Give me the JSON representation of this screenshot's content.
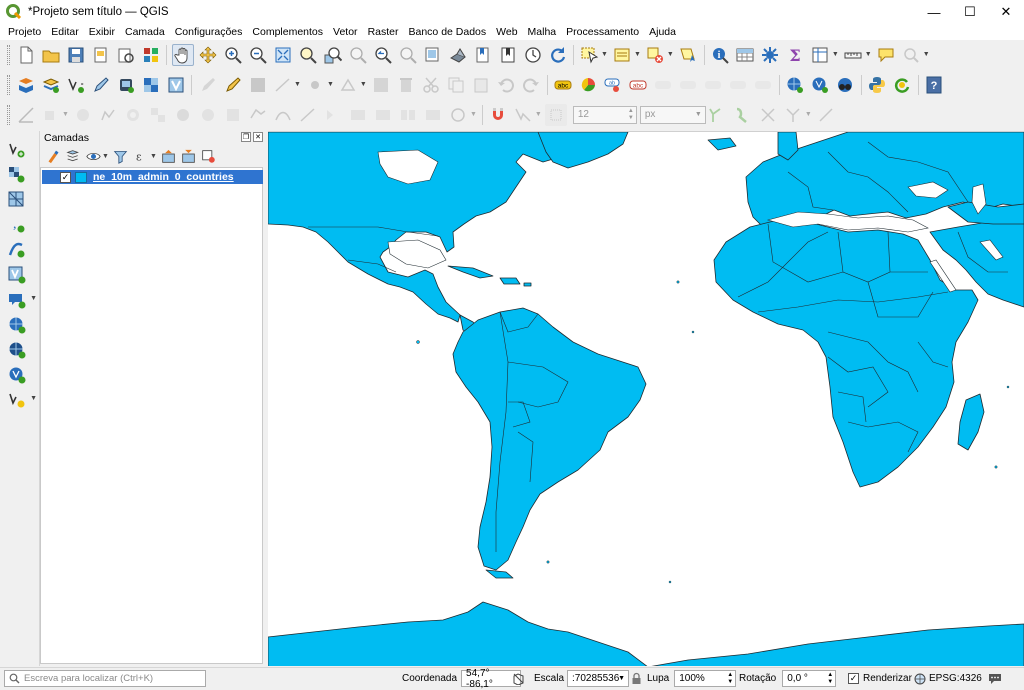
{
  "window": {
    "title": "*Projeto sem título — QGIS",
    "minimize": "—",
    "maximize": "☐",
    "close": "✕"
  },
  "menu": [
    "Projeto",
    "Editar",
    "Exibir",
    "Camada",
    "Configurações",
    "Complementos",
    "Vetor",
    "Raster",
    "Banco de Dados",
    "Web",
    "Malha",
    "Processamento",
    "Ajuda"
  ],
  "snapping": {
    "tolerance": "12",
    "units": "px"
  },
  "layers_panel": {
    "title": "Camadas",
    "layer": {
      "name": "ne_10m_admin_0_countries",
      "checked": "✓",
      "color": "#00bcf2"
    }
  },
  "map": {
    "fill": "#00bcf2",
    "stroke": "#1e2a30",
    "background": "#ffffff"
  },
  "status": {
    "locator_placeholder": "Escreva para localizar (Ctrl+K)",
    "coord_label": "Coordenada",
    "coord_value": "54,7° -86,1°",
    "scale_label": "Escala",
    "scale_value": ":70285536",
    "magnifier_label": "Lupa",
    "magnifier_value": "100%",
    "rotation_label": "Rotação",
    "rotation_value": "0,0 °",
    "render_label": "Renderizar",
    "render_checked": "✓",
    "crs": "EPSG:4326"
  }
}
